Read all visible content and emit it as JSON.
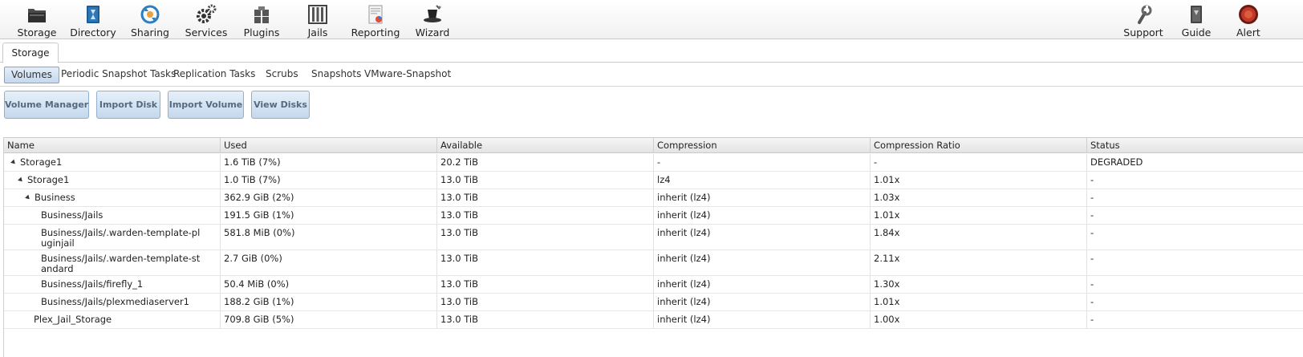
{
  "toolbar": {
    "items": [
      {
        "label": "Storage",
        "icon": "storage-icon"
      },
      {
        "label": "Directory",
        "icon": "directory-icon"
      },
      {
        "label": "Sharing",
        "icon": "sharing-icon"
      },
      {
        "label": "Services",
        "icon": "services-icon"
      },
      {
        "label": "Plugins",
        "icon": "plugins-icon"
      },
      {
        "label": "Jails",
        "icon": "jails-icon"
      },
      {
        "label": "Reporting",
        "icon": "reporting-icon"
      },
      {
        "label": "Wizard",
        "icon": "wizard-icon"
      },
      {
        "label": "Support",
        "icon": "support-icon"
      },
      {
        "label": "Guide",
        "icon": "guide-icon"
      },
      {
        "label": "Alert",
        "icon": "alert-icon"
      }
    ]
  },
  "tabs": {
    "active": "Storage"
  },
  "subtabs": [
    {
      "label": "Volumes",
      "active": true
    },
    {
      "label": "Periodic Snapshot Tasks"
    },
    {
      "label": "Replication Tasks"
    },
    {
      "label": "Scrubs"
    },
    {
      "label": "Snapshots"
    },
    {
      "label": "VMware-Snapshot"
    }
  ],
  "actions": [
    {
      "label": "Volume Manager"
    },
    {
      "label": "Import Disk"
    },
    {
      "label": "Import Volume"
    },
    {
      "label": "View Disks"
    }
  ],
  "table": {
    "columns": [
      "Name",
      "Used",
      "Available",
      "Compression",
      "Compression Ratio",
      "Status"
    ],
    "rows": [
      {
        "name": "Storage1",
        "used": "1.6 TiB (7%)",
        "available": "20.2 TiB",
        "compression": "-",
        "ratio": "-",
        "status": "DEGRADED"
      },
      {
        "name": "Storage1",
        "used": "1.0 TiB (7%)",
        "available": "13.0 TiB",
        "compression": "lz4",
        "ratio": "1.01x",
        "status": "-"
      },
      {
        "name": "Business",
        "used": "362.9 GiB (2%)",
        "available": "13.0 TiB",
        "compression": "inherit (lz4)",
        "ratio": "1.03x",
        "status": "-"
      },
      {
        "name": "Business/Jails",
        "used": "191.5 GiB (1%)",
        "available": "13.0 TiB",
        "compression": "inherit (lz4)",
        "ratio": "1.01x",
        "status": "-"
      },
      {
        "name": "Business/Jails/.warden-template-pluginjail",
        "used": "581.8 MiB (0%)",
        "available": "13.0 TiB",
        "compression": "inherit (lz4)",
        "ratio": "1.84x",
        "status": "-"
      },
      {
        "name": "Business/Jails/.warden-template-standard",
        "used": "2.7 GiB (0%)",
        "available": "13.0 TiB",
        "compression": "inherit (lz4)",
        "ratio": "2.11x",
        "status": "-"
      },
      {
        "name": "Business/Jails/firefly_1",
        "used": "50.4 MiB (0%)",
        "available": "13.0 TiB",
        "compression": "inherit (lz4)",
        "ratio": "1.30x",
        "status": "-"
      },
      {
        "name": "Business/Jails/plexmediaserver1",
        "used": "188.2 GiB (1%)",
        "available": "13.0 TiB",
        "compression": "inherit (lz4)",
        "ratio": "1.01x",
        "status": "-"
      },
      {
        "name": "Plex_Jail_Storage",
        "used": "709.8 GiB (5%)",
        "available": "13.0 TiB",
        "compression": "inherit (lz4)",
        "ratio": "1.00x",
        "status": "-"
      }
    ]
  }
}
